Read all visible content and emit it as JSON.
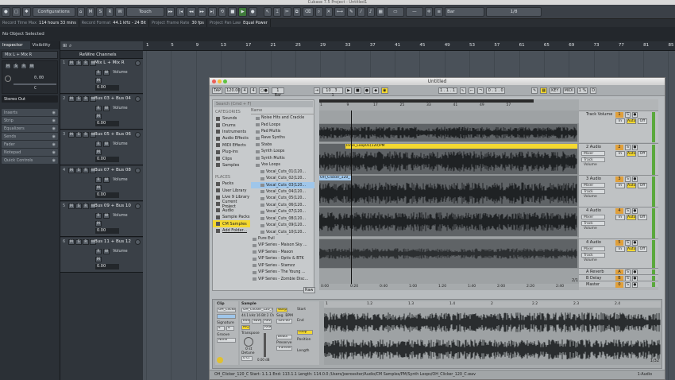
{
  "app": {
    "window_title": "Cubase 7.5 Project - Untitled1"
  },
  "toolbar": {
    "configurations_label": "Configurations",
    "m": "M",
    "s": "S",
    "r": "R",
    "w": "W",
    "touch_label": "Touch",
    "grid_label": "Bar",
    "quantize_label": "1/8"
  },
  "info_bar": [
    {
      "label": "Record Time Max",
      "value": "114 hours 33 mins"
    },
    {
      "label": "Record Format",
      "value": "44.1 kHz - 24 Bit"
    },
    {
      "label": "Project Frame Rate",
      "value": "30 fps"
    },
    {
      "label": "Project Pan Law",
      "value": "Equal Power"
    }
  ],
  "selection_status": "No Object Selected",
  "inspector": {
    "tabs": [
      "Inspector",
      "Visibility"
    ],
    "track_name": "Mix L + Mix R",
    "volume_value": "0.00",
    "pan_value": "C",
    "output": "Stereo Out",
    "sections": [
      "Inserts",
      "Strip",
      "Equalizers",
      "Sends",
      "Fader",
      "Notepad",
      "Quick Controls"
    ]
  },
  "tracklist": {
    "folder_name": "ReWire Channels",
    "tracks": [
      {
        "name": "Mix L + Mix R",
        "vol_label": "Volume",
        "vol": "0.00"
      },
      {
        "name": "Bus 03 + Bus 04",
        "vol_label": "Volume",
        "vol": "0.00"
      },
      {
        "name": "Bus 05 + Bus 06",
        "vol_label": "Volume",
        "vol": "0.00"
      },
      {
        "name": "Bus 07 + Bus 08",
        "vol_label": "Volume",
        "vol": "0.00"
      },
      {
        "name": "Bus 09 + Bus 10",
        "vol_label": "Volume",
        "vol": "0.00"
      },
      {
        "name": "Bus 11 + Bus 12",
        "vol_label": "Volume",
        "vol": "0.00"
      }
    ]
  },
  "ruler_ticks": [
    "1",
    "5",
    "9",
    "13",
    "17",
    "21",
    "25",
    "29",
    "33",
    "37",
    "41",
    "45",
    "49",
    "53",
    "57",
    "61",
    "65",
    "69",
    "73",
    "77",
    "81",
    "85"
  ],
  "ableton": {
    "title": "Untitled",
    "control_bar": {
      "tap": "TAP",
      "tempo": "120.00",
      "sig_num": "4",
      "sig_den": "4",
      "bar_label": "1 Bar",
      "position": "10 . 3 . 1",
      "loop_pos": "1 . 1 . 1",
      "loop_len": "0 . 1 . 0",
      "key": "KEY",
      "midi": "MIDI",
      "cpu": "1 %",
      "d": "D"
    },
    "browser": {
      "search_placeholder": "Search (Cmd + F)",
      "categories_head": "CATEGORIES",
      "categories": [
        "Sounds",
        "Drums",
        "Instruments",
        "Audio Effects",
        "MIDI Effects",
        "Plug-ins",
        "Clips",
        "Samples"
      ],
      "places_head": "PLACES",
      "places": [
        "Packs",
        "User Library",
        "Live 9 Library",
        "Current Project",
        "Audio",
        "Sample Packs",
        "CM Samples",
        "Add Folder..."
      ],
      "name_head": "Name",
      "items": [
        "Noise Hits and Crackle",
        "Pad Loops",
        "Pad Multis",
        "Rave Synths",
        "Stabs",
        "Synth Loops",
        "Synth Multis",
        "Vox Loops",
        "Vocal_Cuts_01(120...",
        "Vocal_Cuts_02(120...",
        "Vocal_Cuts_03(120...",
        "Vocal_Cuts_04(120...",
        "Vocal_Cuts_05(120...",
        "Vocal_Cuts_06(120...",
        "Vocal_Cuts_07(120...",
        "Vocal_Cuts_08(120...",
        "Vocal_Cuts_09(120...",
        "Vocal_Cuts_10(120...",
        "Pure Evil",
        "VIP Series - Maison Sky ...",
        "VIP Series - Mason",
        "VIP Series - Optiv & BTK",
        "VIP Series - Stamzz",
        "VIP Series - The Young ...",
        "VIP Series - Zombie Disc..."
      ],
      "raw_label": "Raw"
    },
    "arrangement": {
      "marker_labels": [
        "1",
        "9",
        "17",
        "25",
        "33",
        "41",
        "49",
        "57"
      ],
      "clip_labels": [
        "Indie_Loop01(120)PM",
        "OH_Clicker_120_"
      ],
      "time_labels": [
        "0:00",
        "0:20",
        "0:40",
        "1:00",
        "1:20",
        "1:40",
        "2:00",
        "2:20",
        "2:40"
      ],
      "page": "2/1"
    },
    "tracks": [
      {
        "name": "Track Volume",
        "num": "1",
        "in": "In",
        "auto": "Auto",
        "off": "Off"
      },
      {
        "name": "2 Audio",
        "num": "2",
        "in": "In",
        "auto": "Auto",
        "off": "Off",
        "sub1": "Mixer",
        "sub2": "Track Volume"
      },
      {
        "name": "3 Audio",
        "num": "3",
        "in": "In",
        "auto": "Auto",
        "off": "Off",
        "sub1": "Mixer",
        "sub2": "Track Volume"
      },
      {
        "name": "4 Audio",
        "num": "4",
        "in": "In",
        "auto": "Auto",
        "off": "Off",
        "sub1": "Mixer",
        "sub2": "Track Volume"
      },
      {
        "name": "4 Audio",
        "num": "5",
        "in": "In",
        "auto": "Auto",
        "off": "Off",
        "sub1": "Mixer",
        "sub2": "Track Volume"
      },
      {
        "name": "A Reverb",
        "num": "A",
        "sub1": "Mixer"
      },
      {
        "name": "B Delay",
        "num": "B",
        "sub1": "Mixer"
      },
      {
        "name": "Master",
        "num": "0"
      }
    ],
    "detail": {
      "clip_title": "Clip",
      "clip_name": "OH_Clicker",
      "signature_label": "Signature",
      "sig_num": "4",
      "sig_den": "4",
      "groove_label": "Groove",
      "groove_val": "None",
      "sample_title": "Sample",
      "sample_name": "OH_Clicker_120_C",
      "sample_info": "44.1 kHz 16 Bit 2 Ch",
      "warp_label": "Warp",
      "edit": "Edit",
      "save": "Save",
      "rev": "Rev",
      "seg_bpm_label": "Seg. BPM",
      "seg_bpm": "120.00",
      "hiq": "HiQ",
      "ram": "RAM",
      "transpose_label": "Transpose",
      "transpose_val": "0 st",
      "detune_label": "Detune",
      "detune_val": "0 ct",
      "gain_val": "0.00 dB",
      "beats_label": "Beats",
      "preserve_label": "Preserve",
      "transients_label": "Transients",
      "start_label": "Start",
      "end_label": "End",
      "loop_label": "Loop",
      "position_label": "Position",
      "length_label": "Length",
      "wave_ticks": [
        "1",
        "1.2",
        "1.3",
        "1.4",
        "2",
        "2.2",
        "2.3",
        "2.4"
      ],
      "page": "1/32"
    },
    "status": {
      "text": "OH_Clicker_120_C   Start: 1.1.1   End: 113.1.1   Length: 114.0.0   /Users/joerossiter/Audio/CM Samples/PM/Synth Loops/OH_Clicker_120_C.wav",
      "right": "1-Audio"
    }
  },
  "colors": {
    "cubase_bg": "#4a5159",
    "ableton_yellow": "#f4d830",
    "ableton_orange": "#e0a03c",
    "selection_blue": "#9fc6ea"
  }
}
